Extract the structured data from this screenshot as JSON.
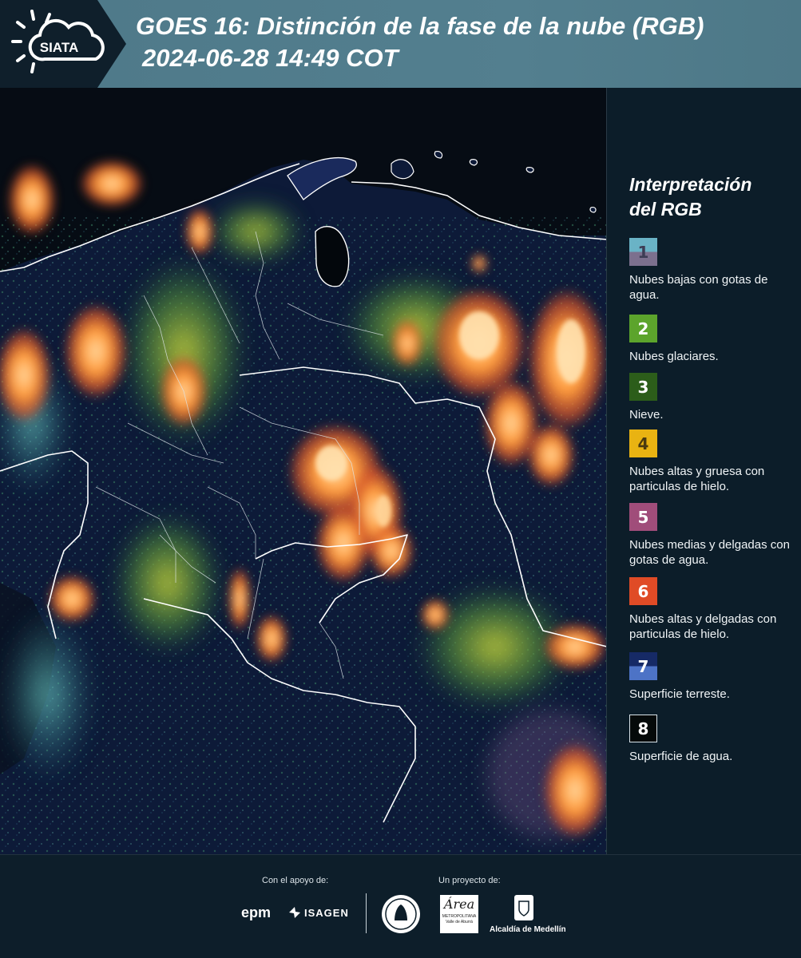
{
  "header": {
    "logo_text": "SIATA",
    "title": "GOES 16: Distinción de la fase de la nube (RGB)",
    "subtitle": "2024-06-28 14:49 COT"
  },
  "legend": {
    "title_line1": "Interpretación",
    "title_line2": "del RGB",
    "items": [
      {
        "num": "1",
        "label": "Nubes bajas con gotas de agua.",
        "colors": [
          "#6ab3c6",
          "#7c708e"
        ],
        "text_color": "#3d3d55"
      },
      {
        "num": "2",
        "label": "Nubes glaciares.",
        "colors": [
          "#5ca42c"
        ],
        "text_color": "#ffffff"
      },
      {
        "num": "3",
        "label": "Nieve.",
        "colors": [
          "#2c5d1a"
        ],
        "text_color": "#ffffff"
      },
      {
        "num": "4",
        "label": "Nubes altas y gruesa con particulas de hielo.",
        "colors": [
          "#e9b312"
        ],
        "text_color": "#4a3a10"
      },
      {
        "num": "5",
        "label": "Nubes medias y delgadas con gotas de agua.",
        "colors": [
          "#a04d7a"
        ],
        "text_color": "#ffffff"
      },
      {
        "num": "6",
        "label": "Nubes altas y delgadas con particulas de hielo.",
        "colors": [
          "#e04b26"
        ],
        "text_color": "#ffffff"
      },
      {
        "num": "7",
        "label": "Superficie terreste.",
        "colors": [
          "#162a66",
          "#4d73c6"
        ],
        "text_color": "#ffffff"
      },
      {
        "num": "8",
        "label": "Superficie de agua.",
        "colors": [
          "#050a0a"
        ],
        "text_color": "#ffffff"
      }
    ]
  },
  "footer": {
    "support_caption": "Con el apoyo de:",
    "project_caption": "Un proyecto de:",
    "logos": {
      "epm": "epm",
      "isagen": "ISAGEN",
      "area_metro": "Área",
      "area_metro_sub": "METROPOLITANA",
      "area_metro_sub2": "Valle de Aburrá",
      "alcaldia": "Alcaldía de Medellín"
    }
  },
  "colors": {
    "header_band": "#537f8f",
    "background": "#0d1e2a",
    "map_ocean": "#050a14"
  }
}
